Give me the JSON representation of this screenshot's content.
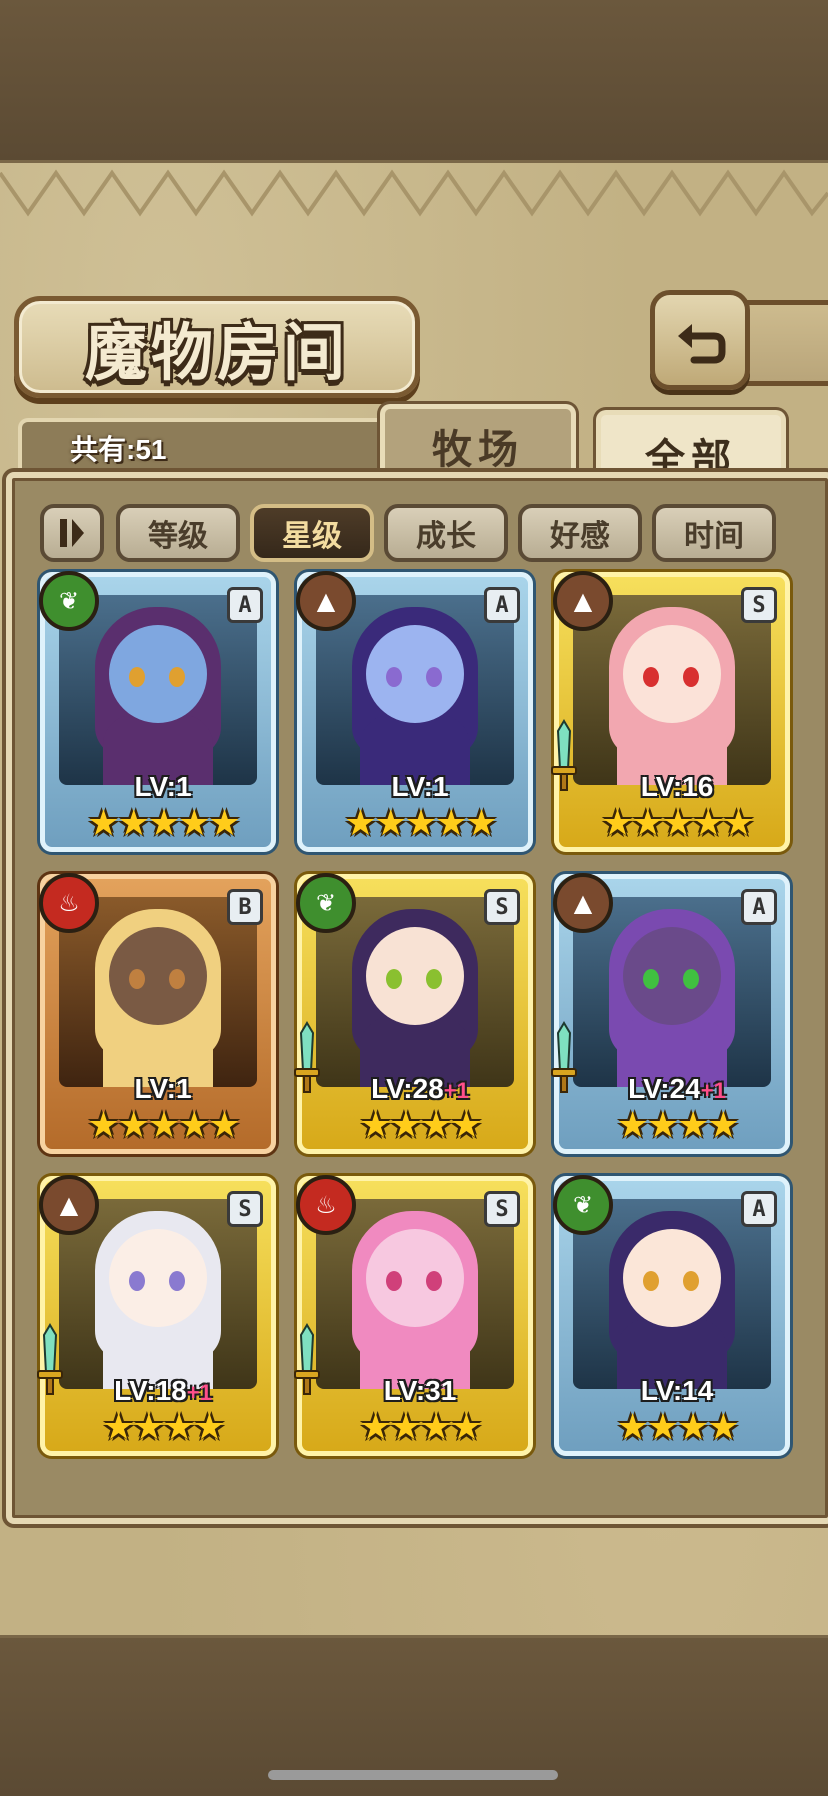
{
  "header": {
    "title": "魔物房间",
    "back_icon": "return-arrow-icon"
  },
  "tabs": {
    "count_label": "共有:51",
    "farm_label": "牧场",
    "all_label": "全部",
    "active": "全部"
  },
  "filters": {
    "items": [
      "等级",
      "星级",
      "成长",
      "好感",
      "时间"
    ],
    "active": "星级"
  },
  "monsters": [
    {
      "element": "nature",
      "rank": "A",
      "level": "LV:1",
      "plus": "",
      "stars": "★★★★★",
      "frame": "a",
      "skin": "#7fa7e0",
      "hair": "#5a2f6e",
      "eyes": "#e0a030",
      "weapon": false
    },
    {
      "element": "earth",
      "rank": "A",
      "level": "LV:1",
      "plus": "",
      "stars": "★★★★★",
      "frame": "a",
      "skin": "#9cb4f0",
      "hair": "#3a2a7a",
      "eyes": "#8a6ad0",
      "weapon": false
    },
    {
      "element": "earth",
      "rank": "S",
      "level": "LV:16",
      "plus": "",
      "stars": "★★★★★",
      "frame": "s",
      "skin": "#fbe2d8",
      "hair": "#f2a7b0",
      "eyes": "#d83030",
      "weapon": true
    },
    {
      "element": "fire",
      "rank": "B",
      "level": "LV:1",
      "plus": "",
      "stars": "★★★★★",
      "frame": "b",
      "skin": "#7a5a44",
      "hair": "#f0d080",
      "eyes": "#c08040",
      "weapon": false
    },
    {
      "element": "nature",
      "rank": "S",
      "level": "LV:28",
      "plus": "+1",
      "stars": "★★★★",
      "frame": "s",
      "skin": "#f8e2d4",
      "hair": "#3e2a5e",
      "eyes": "#8ac030",
      "weapon": true
    },
    {
      "element": "earth",
      "rank": "A",
      "level": "LV:24",
      "plus": "+1",
      "stars": "★★★★",
      "frame": "a",
      "skin": "#6a4a8a",
      "hair": "#7a4ab0",
      "eyes": "#40c040",
      "weapon": true
    },
    {
      "element": "earth",
      "rank": "S",
      "level": "LV:18",
      "plus": "+1",
      "stars": "★★★★",
      "frame": "s",
      "skin": "#fbeee6",
      "hair": "#e8e8f0",
      "eyes": "#8a7ad0",
      "weapon": true
    },
    {
      "element": "fire",
      "rank": "S",
      "level": "LV:31",
      "plus": "",
      "stars": "★★★★",
      "frame": "s",
      "skin": "#f7c8e0",
      "hair": "#f08ac0",
      "eyes": "#d0407a",
      "weapon": true
    },
    {
      "element": "nature",
      "rank": "A",
      "level": "LV:14",
      "plus": "",
      "stars": "★★★★",
      "frame": "a",
      "skin": "#fbe6d8",
      "hair": "#3a2a6a",
      "eyes": "#e0a030",
      "weapon": false
    }
  ]
}
